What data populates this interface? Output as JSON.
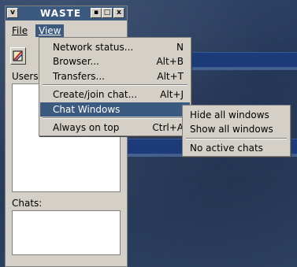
{
  "window": {
    "title": "WASTE",
    "menu": {
      "file": "File",
      "view": "View"
    },
    "users_label": "Users",
    "chats_label": "Chats:"
  },
  "view_menu": {
    "items": [
      {
        "label": "Network status...",
        "shortcut": "N"
      },
      {
        "label": "Browser...",
        "shortcut": "Alt+B"
      },
      {
        "label": "Transfers...",
        "shortcut": "Alt+T"
      },
      {
        "label": "Create/join chat...",
        "shortcut": "Alt+J"
      },
      {
        "label": "Chat Windows",
        "shortcut": ""
      },
      {
        "label": "Always on top",
        "shortcut": "Ctrl+A"
      }
    ]
  },
  "chat_windows_submenu": {
    "items": [
      {
        "label": "Hide all windows"
      },
      {
        "label": "Show all windows"
      },
      {
        "label": "No active chats"
      }
    ]
  },
  "colors": {
    "titlebar": "#3c5a80",
    "highlight": "#3c5a80",
    "desktop": "#2b3f5e"
  }
}
